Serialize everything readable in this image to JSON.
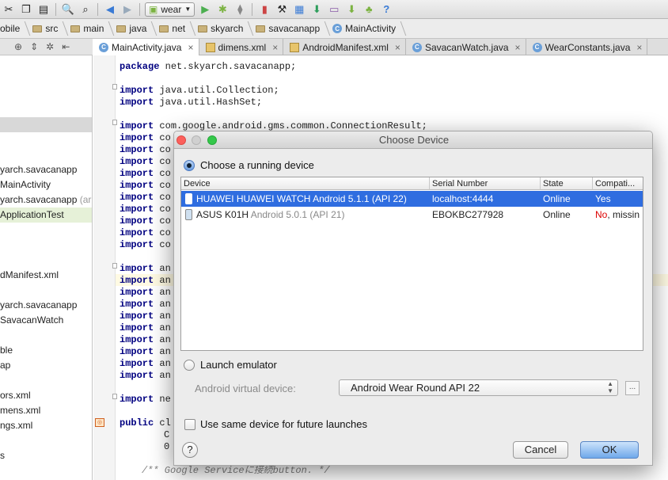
{
  "toolbar": {
    "run_config": "wear",
    "icons": [
      "cut-icon",
      "copy-icon",
      "paste-icon",
      "find-icon",
      "replace-icon",
      "back-icon",
      "forward-icon",
      "run-config-icon",
      "run-icon",
      "debug-icon",
      "attach-debugger-icon",
      "sync-icon",
      "sdk-manager-icon",
      "structure-icon",
      "android-monitor-icon",
      "avd-manager-icon",
      "android-icon",
      "help-icon"
    ]
  },
  "breadcrumbs": [
    "obile",
    "src",
    "main",
    "java",
    "net",
    "skyarch",
    "savacanapp",
    "MainActivity"
  ],
  "tabs": [
    {
      "label": "MainActivity.java",
      "type": "class",
      "active": true
    },
    {
      "label": "dimens.xml",
      "type": "xml",
      "active": false
    },
    {
      "label": "AndroidManifest.xml",
      "type": "xml",
      "active": false
    },
    {
      "label": "SavacanWatch.java",
      "type": "class",
      "active": false
    },
    {
      "label": "WearConstants.java",
      "type": "class",
      "active": false
    }
  ],
  "sidebar": {
    "items": [
      {
        "label": "yarch.savacanapp",
        "suffix": ""
      },
      {
        "label": "MainActivity",
        "suffix": ""
      },
      {
        "label": "yarch.savacanapp",
        "suffix": " (ar"
      },
      {
        "label": "ApplicationTest",
        "suffix": ""
      },
      {
        "label": "dManifest.xml",
        "suffix": ""
      },
      {
        "label": "yarch.savacanapp",
        "suffix": ""
      },
      {
        "label": "SavacanWatch",
        "suffix": ""
      },
      {
        "label": "ble",
        "suffix": ""
      },
      {
        "label": "ap",
        "suffix": ""
      },
      {
        "label": "ors.xml",
        "suffix": ""
      },
      {
        "label": "mens.xml",
        "suffix": ""
      },
      {
        "label": "ngs.xml",
        "suffix": ""
      },
      {
        "label": "s",
        "suffix": ""
      }
    ]
  },
  "code": {
    "line1_kw": "package",
    "line1": " net.skyarch.savacanapp;",
    "line2_kw": "import",
    "line2": " java.util.Collection;",
    "line3_kw": "import",
    "line3": " java.util.HashSet;",
    "line4_kw": "import",
    "line4": " com.google.android.gms.common.ConnectionResult;",
    "co_kw": "import",
    "co": " co",
    "an_kw": "import",
    "an": " an",
    "ne_kw": "import",
    "ne": " ne",
    "cl_kw": "public",
    "cl": " cl",
    "c_text": "C",
    "o_text": "0",
    "comment": "/** Google Serviceに接続button. */"
  },
  "dialog": {
    "title": "Choose Device",
    "running_label": "Choose a running device",
    "columns": [
      "Device",
      "Serial Number",
      "State",
      "Compati..."
    ],
    "devices": [
      {
        "name": "HUAWEI HUAWEI WATCH",
        "version": "Android 5.1.1 (API 22)",
        "serial": "localhost:4444",
        "state": "Online",
        "compat": "Yes",
        "compat_extra": "",
        "selected": true
      },
      {
        "name": "ASUS K01H",
        "version": "Android 5.0.1 (API 21)",
        "serial": "EBOKBC277928",
        "state": "Online",
        "compat": "No",
        "compat_extra": ", missin",
        "selected": false
      }
    ],
    "emulator_label": "Launch emulator",
    "avd_label": "Android virtual device:",
    "avd_value": "Android Wear Round API 22",
    "avd_more": "...",
    "future_label": "Use same device for future launches",
    "help": "?",
    "cancel": "Cancel",
    "ok": "OK",
    "colors": {
      "selection": "#2f6de0",
      "close": "#fc605c",
      "min": "#d0d0d0",
      "zoom": "#34c84a"
    }
  }
}
